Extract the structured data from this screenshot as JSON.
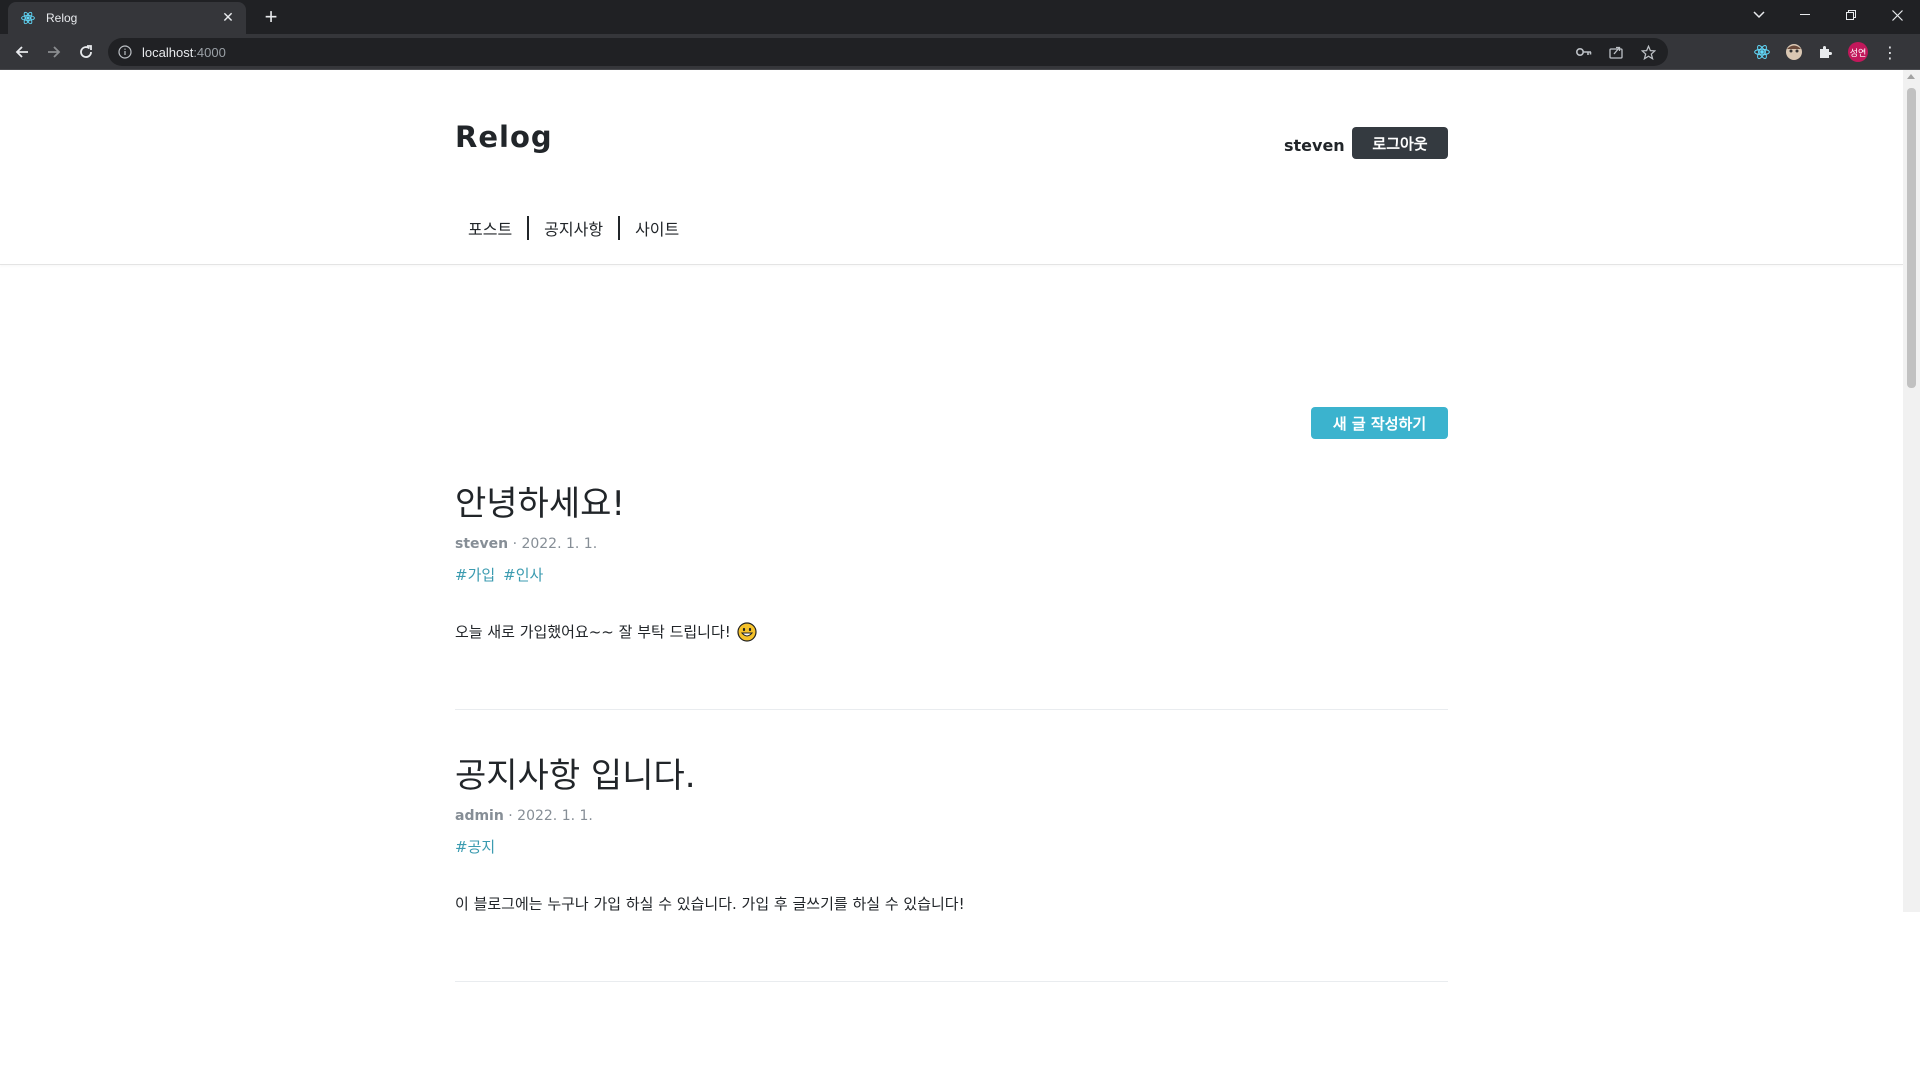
{
  "browser": {
    "tab_title": "Relog",
    "url_host": "localhost",
    "url_port": ":4000",
    "profile_initials": "성연"
  },
  "header": {
    "logo": "Relog",
    "username": "steven",
    "logout_label": "로그아웃",
    "nav": [
      "포스트",
      "공지사항",
      "사이트"
    ]
  },
  "main": {
    "write_label": "새 글 작성하기",
    "posts": [
      {
        "title": "안녕하세요!",
        "author": "steven",
        "date": "· 2022. 1. 1.",
        "tags": [
          "#가입",
          "#인사"
        ],
        "body": "오늘 새로 가입했어요~~ 잘 부탁 드립니다!",
        "emoji": "grinning-face"
      },
      {
        "title": "공지사항 입니다.",
        "author": "admin",
        "date": "· 2022. 1. 1.",
        "tags": [
          "#공지"
        ],
        "body": "이 블로그에는 누구나 가입 하실 수 있습니다. 가입 후 글쓰기를 하실 수 있습니다!"
      }
    ]
  },
  "colors": {
    "accent": "#3bb3ce",
    "dark_button": "#343a40",
    "tag": "#3b9bb0",
    "meta": "#868e96"
  }
}
